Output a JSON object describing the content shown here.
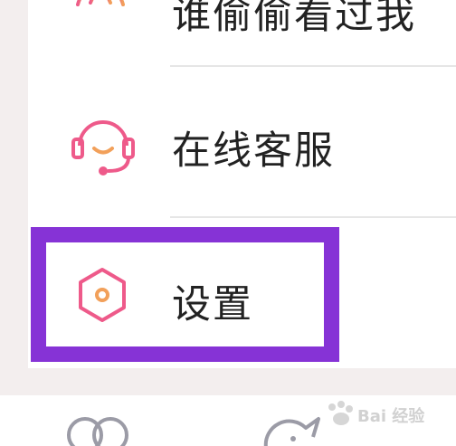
{
  "menu": {
    "items": [
      {
        "label": "谁偷偷看过我",
        "icon": "radar-icon"
      },
      {
        "label": "在线客服",
        "icon": "headset-icon"
      },
      {
        "label": "设置",
        "icon": "hexagon-settings-icon"
      }
    ]
  },
  "tabbar": {
    "icons": [
      "overlap-circles-icon",
      "bird-chat-icon"
    ]
  },
  "watermark": {
    "text": "Bai 经验"
  },
  "colors": {
    "icon_gradient_start": "#ee5a8a",
    "icon_gradient_end": "#f2a05a",
    "highlight": "#8633d6",
    "divider": "#e6e6e6",
    "text": "#222222",
    "background": "#f3eeee",
    "tab_icon": "#9b9ba6"
  }
}
